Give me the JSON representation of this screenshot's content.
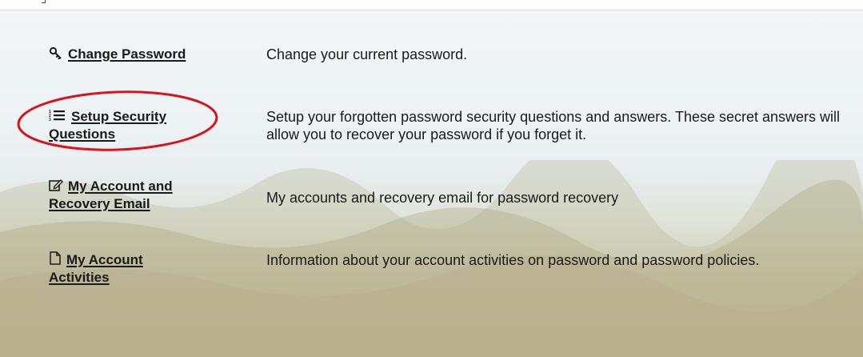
{
  "items": [
    {
      "icon": "key-icon",
      "label": "Change Password",
      "description": "Change your current password."
    },
    {
      "icon": "numbered-list-icon",
      "label": "Setup Security Questions",
      "description": "Setup your forgotten password security questions and answers. These secret answers will allow you to recover your password if you forget it."
    },
    {
      "icon": "edit-icon",
      "label": "My Account and Recovery Email",
      "description": "My accounts and recovery email for password recovery"
    },
    {
      "icon": "document-icon",
      "label": "My Account Activities",
      "description": "Information about your account activities on password and password policies."
    }
  ],
  "highlight_color": "#d8141a",
  "text_color": "#1a1a1a"
}
